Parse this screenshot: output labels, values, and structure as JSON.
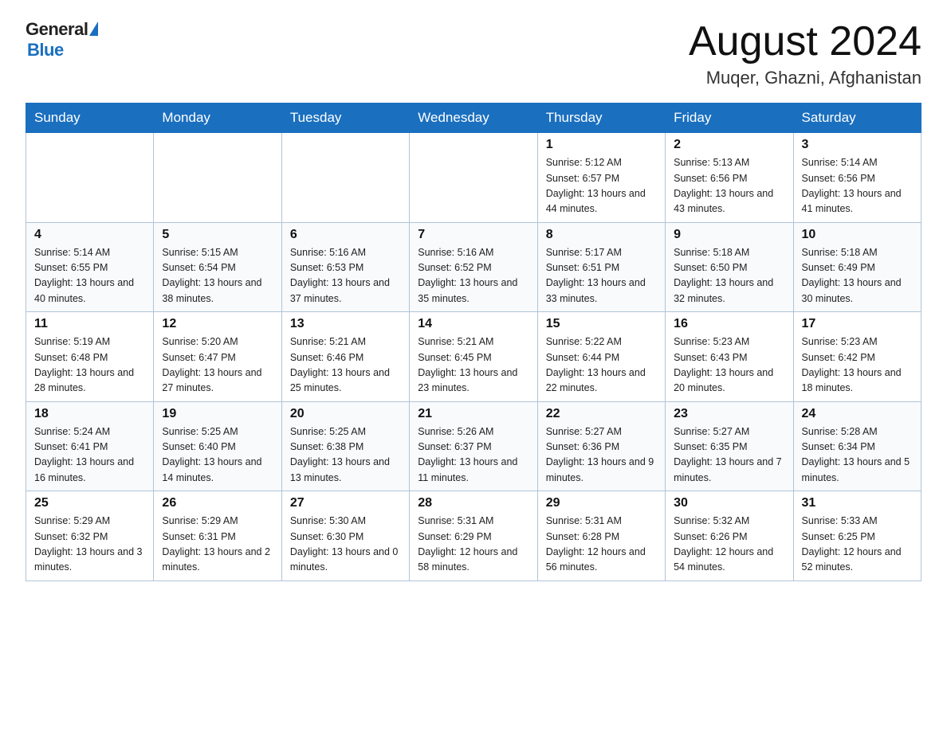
{
  "header": {
    "month_year": "August 2024",
    "location": "Muqer, Ghazni, Afghanistan",
    "logo_general": "General",
    "logo_blue": "Blue"
  },
  "weekdays": [
    "Sunday",
    "Monday",
    "Tuesday",
    "Wednesday",
    "Thursday",
    "Friday",
    "Saturday"
  ],
  "weeks": [
    [
      {
        "day": "",
        "sunrise": "",
        "sunset": "",
        "daylight": ""
      },
      {
        "day": "",
        "sunrise": "",
        "sunset": "",
        "daylight": ""
      },
      {
        "day": "",
        "sunrise": "",
        "sunset": "",
        "daylight": ""
      },
      {
        "day": "",
        "sunrise": "",
        "sunset": "",
        "daylight": ""
      },
      {
        "day": "1",
        "sunrise": "Sunrise: 5:12 AM",
        "sunset": "Sunset: 6:57 PM",
        "daylight": "Daylight: 13 hours and 44 minutes."
      },
      {
        "day": "2",
        "sunrise": "Sunrise: 5:13 AM",
        "sunset": "Sunset: 6:56 PM",
        "daylight": "Daylight: 13 hours and 43 minutes."
      },
      {
        "day": "3",
        "sunrise": "Sunrise: 5:14 AM",
        "sunset": "Sunset: 6:56 PM",
        "daylight": "Daylight: 13 hours and 41 minutes."
      }
    ],
    [
      {
        "day": "4",
        "sunrise": "Sunrise: 5:14 AM",
        "sunset": "Sunset: 6:55 PM",
        "daylight": "Daylight: 13 hours and 40 minutes."
      },
      {
        "day": "5",
        "sunrise": "Sunrise: 5:15 AM",
        "sunset": "Sunset: 6:54 PM",
        "daylight": "Daylight: 13 hours and 38 minutes."
      },
      {
        "day": "6",
        "sunrise": "Sunrise: 5:16 AM",
        "sunset": "Sunset: 6:53 PM",
        "daylight": "Daylight: 13 hours and 37 minutes."
      },
      {
        "day": "7",
        "sunrise": "Sunrise: 5:16 AM",
        "sunset": "Sunset: 6:52 PM",
        "daylight": "Daylight: 13 hours and 35 minutes."
      },
      {
        "day": "8",
        "sunrise": "Sunrise: 5:17 AM",
        "sunset": "Sunset: 6:51 PM",
        "daylight": "Daylight: 13 hours and 33 minutes."
      },
      {
        "day": "9",
        "sunrise": "Sunrise: 5:18 AM",
        "sunset": "Sunset: 6:50 PM",
        "daylight": "Daylight: 13 hours and 32 minutes."
      },
      {
        "day": "10",
        "sunrise": "Sunrise: 5:18 AM",
        "sunset": "Sunset: 6:49 PM",
        "daylight": "Daylight: 13 hours and 30 minutes."
      }
    ],
    [
      {
        "day": "11",
        "sunrise": "Sunrise: 5:19 AM",
        "sunset": "Sunset: 6:48 PM",
        "daylight": "Daylight: 13 hours and 28 minutes."
      },
      {
        "day": "12",
        "sunrise": "Sunrise: 5:20 AM",
        "sunset": "Sunset: 6:47 PM",
        "daylight": "Daylight: 13 hours and 27 minutes."
      },
      {
        "day": "13",
        "sunrise": "Sunrise: 5:21 AM",
        "sunset": "Sunset: 6:46 PM",
        "daylight": "Daylight: 13 hours and 25 minutes."
      },
      {
        "day": "14",
        "sunrise": "Sunrise: 5:21 AM",
        "sunset": "Sunset: 6:45 PM",
        "daylight": "Daylight: 13 hours and 23 minutes."
      },
      {
        "day": "15",
        "sunrise": "Sunrise: 5:22 AM",
        "sunset": "Sunset: 6:44 PM",
        "daylight": "Daylight: 13 hours and 22 minutes."
      },
      {
        "day": "16",
        "sunrise": "Sunrise: 5:23 AM",
        "sunset": "Sunset: 6:43 PM",
        "daylight": "Daylight: 13 hours and 20 minutes."
      },
      {
        "day": "17",
        "sunrise": "Sunrise: 5:23 AM",
        "sunset": "Sunset: 6:42 PM",
        "daylight": "Daylight: 13 hours and 18 minutes."
      }
    ],
    [
      {
        "day": "18",
        "sunrise": "Sunrise: 5:24 AM",
        "sunset": "Sunset: 6:41 PM",
        "daylight": "Daylight: 13 hours and 16 minutes."
      },
      {
        "day": "19",
        "sunrise": "Sunrise: 5:25 AM",
        "sunset": "Sunset: 6:40 PM",
        "daylight": "Daylight: 13 hours and 14 minutes."
      },
      {
        "day": "20",
        "sunrise": "Sunrise: 5:25 AM",
        "sunset": "Sunset: 6:38 PM",
        "daylight": "Daylight: 13 hours and 13 minutes."
      },
      {
        "day": "21",
        "sunrise": "Sunrise: 5:26 AM",
        "sunset": "Sunset: 6:37 PM",
        "daylight": "Daylight: 13 hours and 11 minutes."
      },
      {
        "day": "22",
        "sunrise": "Sunrise: 5:27 AM",
        "sunset": "Sunset: 6:36 PM",
        "daylight": "Daylight: 13 hours and 9 minutes."
      },
      {
        "day": "23",
        "sunrise": "Sunrise: 5:27 AM",
        "sunset": "Sunset: 6:35 PM",
        "daylight": "Daylight: 13 hours and 7 minutes."
      },
      {
        "day": "24",
        "sunrise": "Sunrise: 5:28 AM",
        "sunset": "Sunset: 6:34 PM",
        "daylight": "Daylight: 13 hours and 5 minutes."
      }
    ],
    [
      {
        "day": "25",
        "sunrise": "Sunrise: 5:29 AM",
        "sunset": "Sunset: 6:32 PM",
        "daylight": "Daylight: 13 hours and 3 minutes."
      },
      {
        "day": "26",
        "sunrise": "Sunrise: 5:29 AM",
        "sunset": "Sunset: 6:31 PM",
        "daylight": "Daylight: 13 hours and 2 minutes."
      },
      {
        "day": "27",
        "sunrise": "Sunrise: 5:30 AM",
        "sunset": "Sunset: 6:30 PM",
        "daylight": "Daylight: 13 hours and 0 minutes."
      },
      {
        "day": "28",
        "sunrise": "Sunrise: 5:31 AM",
        "sunset": "Sunset: 6:29 PM",
        "daylight": "Daylight: 12 hours and 58 minutes."
      },
      {
        "day": "29",
        "sunrise": "Sunrise: 5:31 AM",
        "sunset": "Sunset: 6:28 PM",
        "daylight": "Daylight: 12 hours and 56 minutes."
      },
      {
        "day": "30",
        "sunrise": "Sunrise: 5:32 AM",
        "sunset": "Sunset: 6:26 PM",
        "daylight": "Daylight: 12 hours and 54 minutes."
      },
      {
        "day": "31",
        "sunrise": "Sunrise: 5:33 AM",
        "sunset": "Sunset: 6:25 PM",
        "daylight": "Daylight: 12 hours and 52 minutes."
      }
    ]
  ]
}
